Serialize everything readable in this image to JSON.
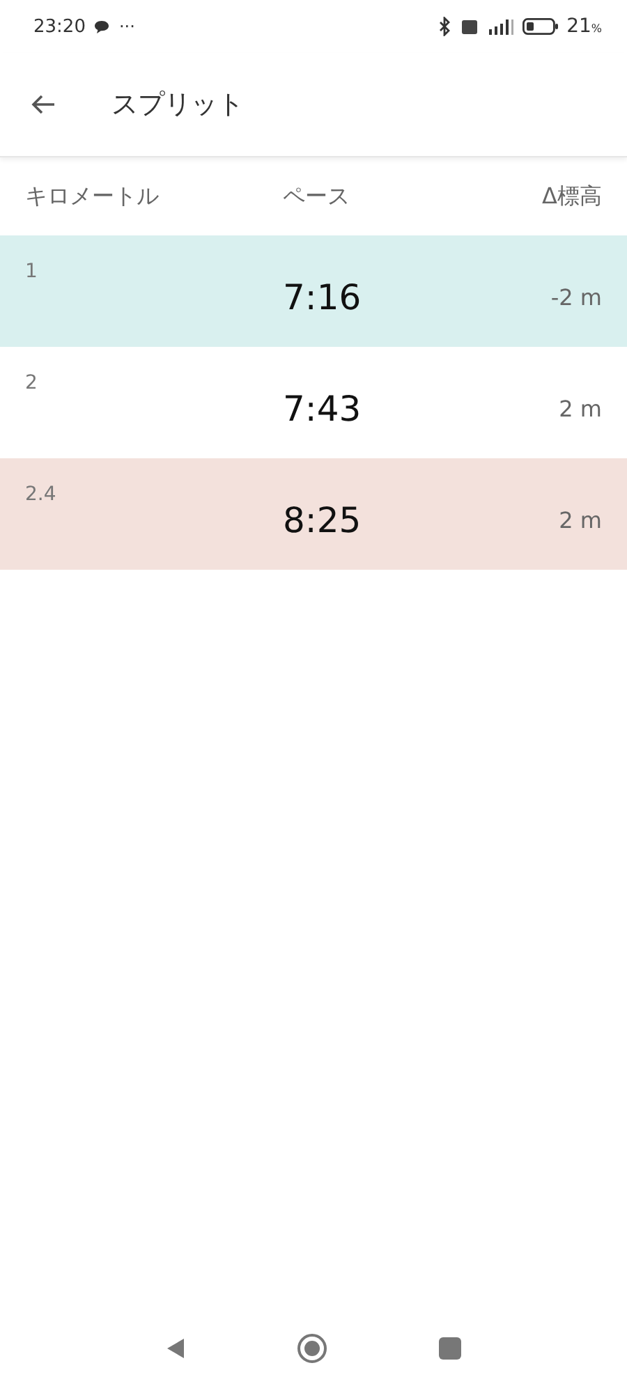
{
  "status_bar": {
    "time": "23:20",
    "more": "···",
    "battery_percent": "21",
    "percent_sign": "%"
  },
  "app_bar": {
    "title": "スプリット"
  },
  "table": {
    "columns": [
      "キロメートル",
      "ペース",
      "Δ標高"
    ],
    "rows": [
      {
        "km": "1",
        "pace": "7:16",
        "elevation": "-2 m",
        "color": "#d9f0ef"
      },
      {
        "km": "2",
        "pace": "7:43",
        "elevation": "2 m",
        "color": "#ffffff"
      },
      {
        "km": "2.4",
        "pace": "8:25",
        "elevation": "2 m",
        "color": "#f3e1dc"
      }
    ]
  }
}
